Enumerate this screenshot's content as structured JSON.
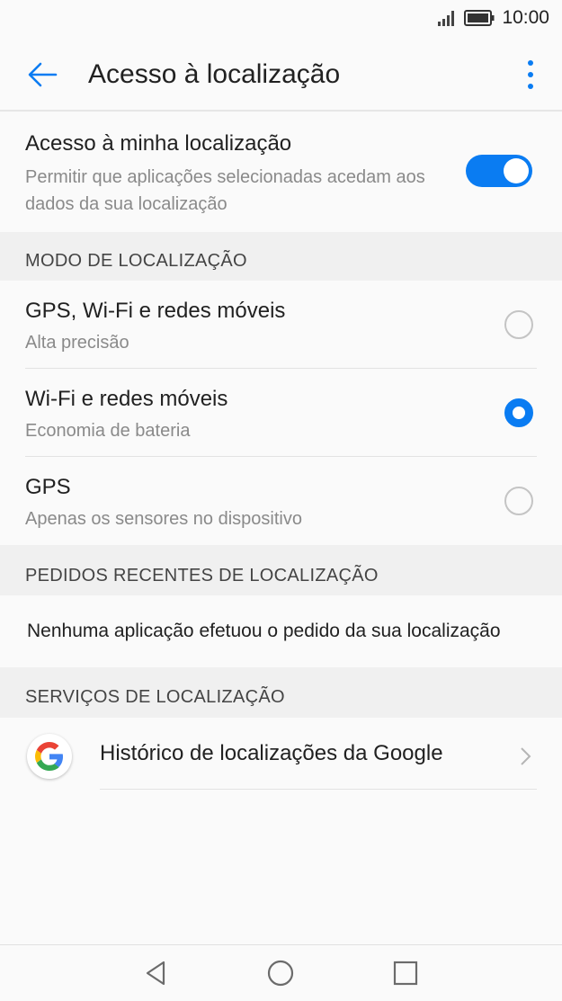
{
  "status": {
    "time": "10:00",
    "signal_icon": "signal-icon",
    "battery_icon": "battery-icon"
  },
  "appbar": {
    "title": "Acesso à localização",
    "back_icon": "back-arrow-icon",
    "menu_icon": "more-vert-icon"
  },
  "location_access": {
    "title": "Acesso à minha localização",
    "description": "Permitir que aplicações selecionadas acedam aos dados da sua localização",
    "enabled": true
  },
  "mode_section": {
    "header": "MODO DE LOCALIZAÇÃO",
    "options": [
      {
        "title": "GPS, Wi-Fi e redes móveis",
        "subtitle": "Alta precisão",
        "selected": false
      },
      {
        "title": "Wi-Fi e redes móveis",
        "subtitle": "Economia de bateria",
        "selected": true
      },
      {
        "title": "GPS",
        "subtitle": "Apenas os sensores no dispositivo",
        "selected": false
      }
    ]
  },
  "recent_section": {
    "header": "PEDIDOS RECENTES DE LOCALIZAÇÃO",
    "empty_text": "Nenhuma aplicação efetuou o pedido da sua localização"
  },
  "services_section": {
    "header": "SERVIÇOS DE LOCALIZAÇÃO",
    "items": [
      {
        "label": "Histórico de localizações da Google",
        "icon": "google-icon"
      }
    ]
  },
  "colors": {
    "accent": "#0a7cf2"
  }
}
